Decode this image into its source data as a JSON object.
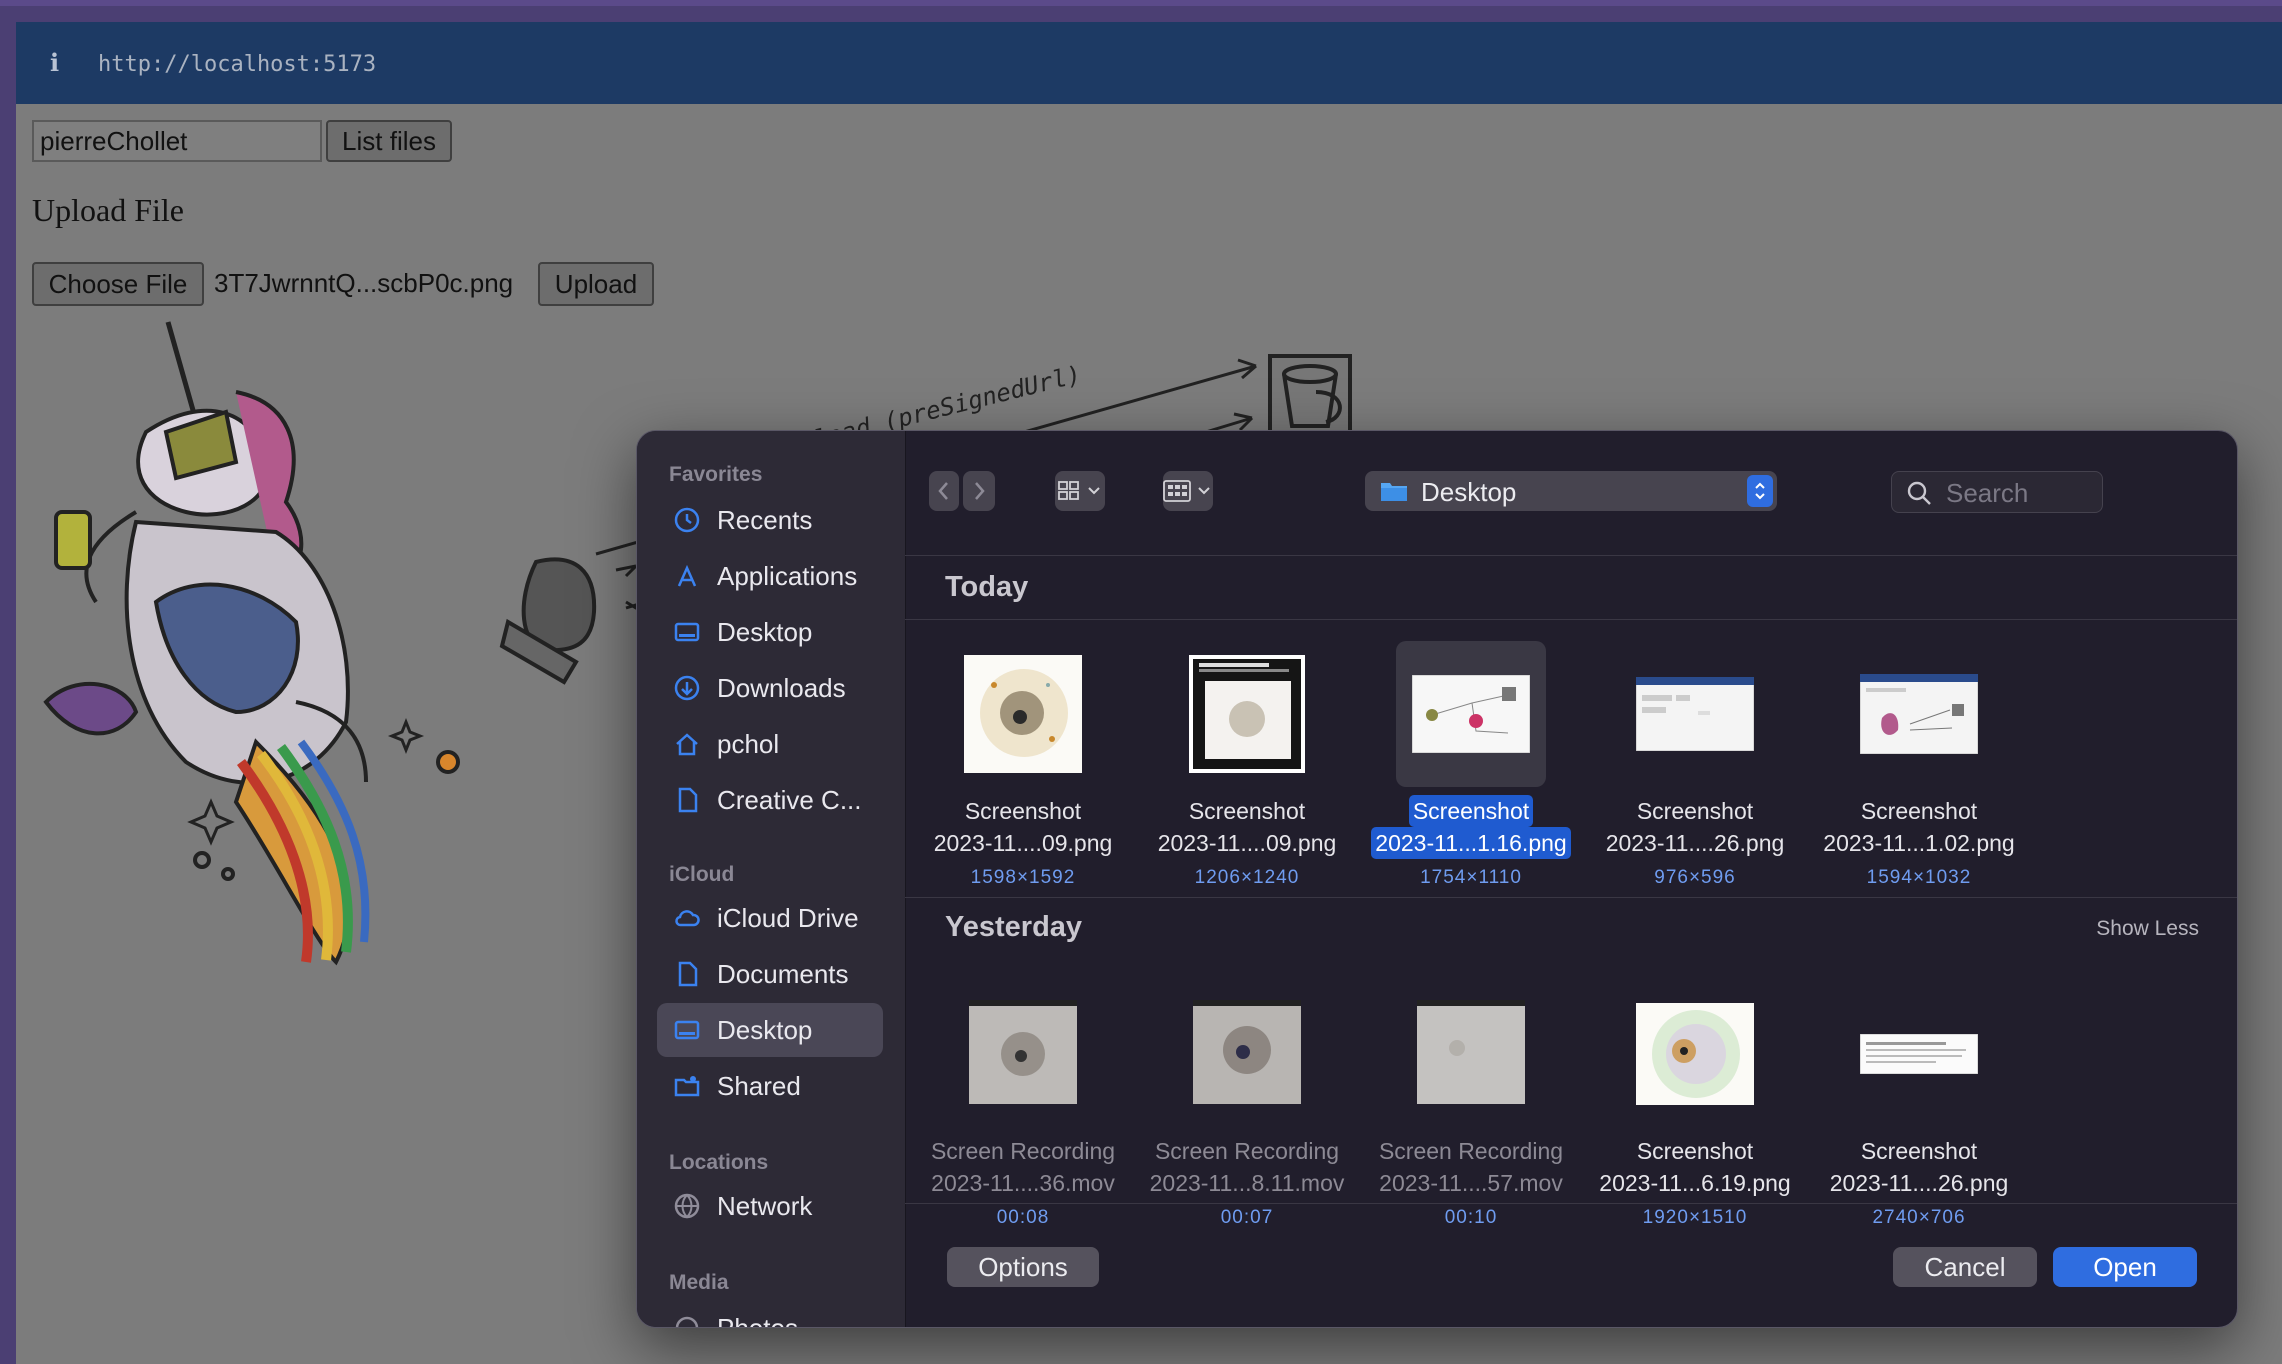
{
  "browser": {
    "url": "http://localhost:5173",
    "info_icon": "i"
  },
  "app": {
    "username_value": "pierreChollet",
    "list_files_label": "List files",
    "upload_heading": "Upload File",
    "choose_file_label": "Choose File",
    "chosen_file_name": "3T7JwrnntQ...scbP0c.png",
    "upload_label": "Upload",
    "diagram_annotation": "load (preSignedUrl)"
  },
  "dialog": {
    "sidebar": {
      "sections": [
        {
          "title": "Favorites",
          "items": [
            {
              "label": "Recents",
              "icon": "clock-icon"
            },
            {
              "label": "Applications",
              "icon": "applications-icon"
            },
            {
              "label": "Desktop",
              "icon": "desktop-icon"
            },
            {
              "label": "Downloads",
              "icon": "download-icon"
            },
            {
              "label": "pchol",
              "icon": "home-icon"
            },
            {
              "label": "Creative C...",
              "icon": "document-icon"
            }
          ]
        },
        {
          "title": "iCloud",
          "items": [
            {
              "label": "iCloud Drive",
              "icon": "cloud-icon"
            },
            {
              "label": "Documents",
              "icon": "document-icon"
            },
            {
              "label": "Desktop",
              "icon": "desktop-icon",
              "selected": true
            },
            {
              "label": "Shared",
              "icon": "shared-folder-icon"
            }
          ]
        },
        {
          "title": "Locations",
          "items": [
            {
              "label": "Network",
              "icon": "globe-icon"
            }
          ]
        },
        {
          "title": "Media",
          "items": [
            {
              "label": "Photos",
              "icon": "photos-icon"
            }
          ]
        }
      ]
    },
    "toolbar": {
      "back_icon": "chevron-left-icon",
      "forward_icon": "chevron-right-icon",
      "view_icon": "grid-view-icon",
      "group_icon": "group-view-icon",
      "location": "Desktop",
      "search_placeholder": "Search"
    },
    "groups": {
      "today": {
        "title": "Today",
        "files": [
          {
            "line1": "Screenshot",
            "line2": "2023-11....09.png",
            "dims": "1598×1592"
          },
          {
            "line1": "Screenshot",
            "line2": "2023-11....09.png",
            "dims": "1206×1240"
          },
          {
            "line1": "Screenshot",
            "line2": "2023-11...1.16.png",
            "dims": "1754×1110",
            "selected": true
          },
          {
            "line1": "Screenshot",
            "line2": "2023-11....26.png",
            "dims": "976×596"
          },
          {
            "line1": "Screenshot",
            "line2": "2023-11...1.02.png",
            "dims": "1594×1032"
          }
        ]
      },
      "yesterday": {
        "title": "Yesterday",
        "show_less": "Show Less",
        "files": [
          {
            "line1": "Screen Recording",
            "line2": "2023-11....36.mov",
            "dims": "00:08",
            "dim": true
          },
          {
            "line1": "Screen Recording",
            "line2": "2023-11...8.11.mov",
            "dims": "00:07",
            "dim": true
          },
          {
            "line1": "Screen Recording",
            "line2": "2023-11....57.mov",
            "dims": "00:10",
            "dim": true
          },
          {
            "line1": "Screenshot",
            "line2": "2023-11...6.19.png",
            "dims": "1920×1510"
          },
          {
            "line1": "Screenshot",
            "line2": "2023-11....26.png",
            "dims": "2740×706"
          }
        ]
      }
    },
    "footer": {
      "options_label": "Options",
      "cancel_label": "Cancel",
      "open_label": "Open"
    }
  },
  "colors": {
    "accent": "#2f6de0",
    "dialog_bg": "#211e2c",
    "sidebar_bg": "#2d2a36",
    "page_bg": "#7c7c7c",
    "urlbar_bg": "#1d3a64"
  }
}
